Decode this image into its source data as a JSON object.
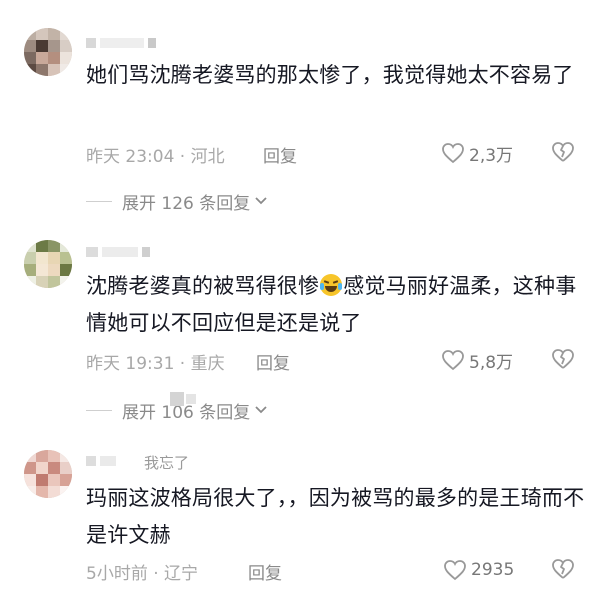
{
  "comments": [
    {
      "text": "她们骂沈腾老婆骂的那太惨了，我觉得她太不容易了",
      "time_location": "昨天 23:04 · 河北",
      "reply_label": "回复",
      "likes": "2,3万",
      "expand_label": "展开 126 条回复"
    },
    {
      "text_before_emoji": "沈腾老婆真的被骂得很惨",
      "emoji": "laughing-crying-emoji",
      "text_after_emoji": "感觉马丽好温柔，这种事情她可以不回应但是还是说了",
      "time_location": "昨天 19:31 · 重庆",
      "reply_label": "回复",
      "likes": "5,8万",
      "expand_label": "展开 106 条回复"
    },
    {
      "username_visible": "我忘了",
      "text": "玛丽这波格局很大了，，因为被骂的最多的是王琦而不是许文赫",
      "time_location": "5小时前 · 辽宁",
      "reply_label": "回复",
      "likes": "2935"
    }
  ],
  "colors": {
    "text": "#161823",
    "meta": "#a8a8a8",
    "reply": "#8a8a8a",
    "icon": "#999999"
  }
}
